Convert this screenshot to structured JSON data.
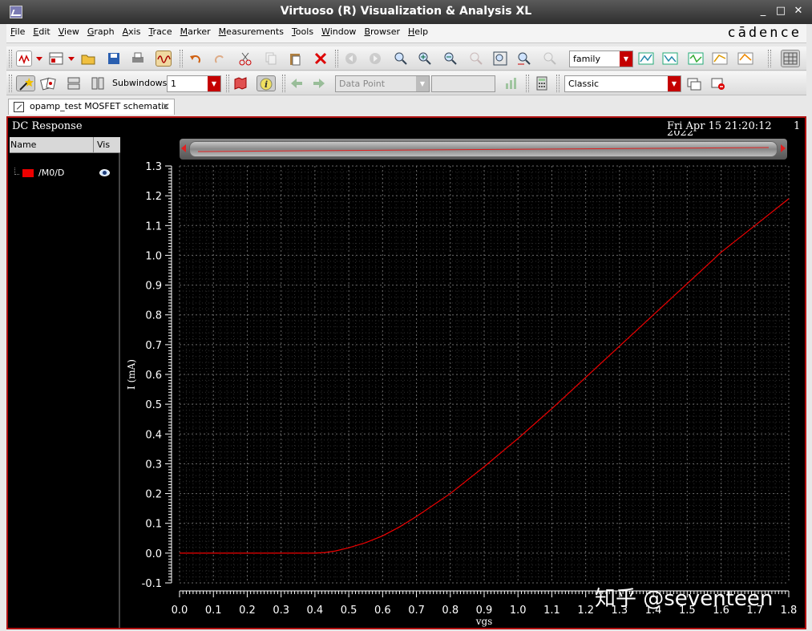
{
  "window": {
    "title": "Virtuoso (R) Visualization & Analysis XL",
    "controls": [
      "_",
      "□",
      "✕"
    ]
  },
  "menubar": {
    "items": [
      "File",
      "Edit",
      "View",
      "Graph",
      "Axis",
      "Trace",
      "Marker",
      "Measurements",
      "Tools",
      "Window",
      "Browser",
      "Help"
    ],
    "brand": "cādence"
  },
  "toolbar1": {
    "family_combo": "family"
  },
  "toolbar2": {
    "subwindows_label": "Subwindows:",
    "subwindows_value": "1",
    "data_point_combo": "Data Point",
    "style_combo": "Classic"
  },
  "tab": {
    "label": "opamp_test MOSFET schematic"
  },
  "plot": {
    "title": "DC Response",
    "date": "Fri Apr 15 21:20:12",
    "date_second_line": "2022",
    "subwindow_number": "1",
    "watermark": "知乎 @seventeen"
  },
  "legend": {
    "header_name": "Name",
    "header_vis": "Vis",
    "trace_label": "/M0/D",
    "trace_color": "#ee0000"
  },
  "chart_data": {
    "type": "line",
    "title": "DC Response",
    "xlabel": "vgs",
    "ylabel": "I (mA)",
    "xlim": [
      0.0,
      1.8
    ],
    "ylim": [
      -0.1,
      1.3
    ],
    "xticks": [
      "0.0",
      "0.1",
      "0.2",
      "0.3",
      "0.4",
      "0.5",
      "0.6",
      "0.7",
      "0.8",
      "0.9",
      "1.0",
      "1.1",
      "1.2",
      "1.3",
      "1.4",
      "1.5",
      "1.6",
      "1.7",
      "1.8"
    ],
    "yticks": [
      "-0.1",
      "0.0",
      "0.1",
      "0.2",
      "0.3",
      "0.4",
      "0.5",
      "0.6",
      "0.7",
      "0.8",
      "0.9",
      "1.0",
      "1.1",
      "1.2",
      "1.3"
    ],
    "grid": true,
    "series": [
      {
        "name": "/M0/D",
        "color": "#ee0000",
        "x": [
          0.0,
          0.1,
          0.2,
          0.3,
          0.35,
          0.4,
          0.43,
          0.46,
          0.5,
          0.55,
          0.6,
          0.65,
          0.7,
          0.8,
          0.9,
          1.0,
          1.1,
          1.2,
          1.3,
          1.4,
          1.5,
          1.6,
          1.7,
          1.8
        ],
        "y": [
          0.0,
          0.0,
          0.0,
          0.0,
          0.0,
          0.0,
          0.002,
          0.007,
          0.018,
          0.035,
          0.058,
          0.088,
          0.123,
          0.2,
          0.29,
          0.385,
          0.485,
          0.59,
          0.695,
          0.8,
          0.905,
          1.01,
          1.1,
          1.19
        ]
      }
    ]
  }
}
